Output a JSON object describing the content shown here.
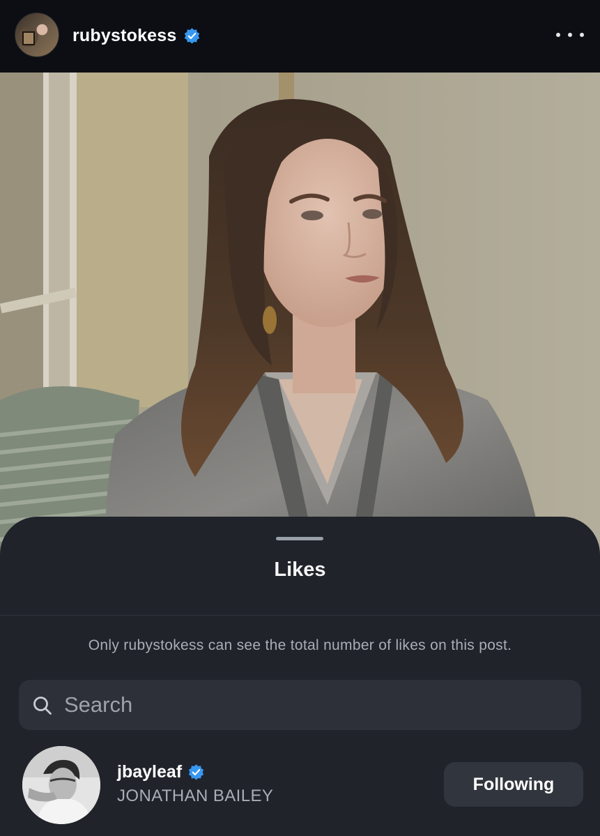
{
  "post": {
    "username": "rubystokess",
    "verified_icon": "verified-badge-icon",
    "more_icon": "more-horizontal-icon"
  },
  "likes_sheet": {
    "title": "Likes",
    "notice": "Only rubystokess can see the total number of likes on this post.",
    "search": {
      "placeholder": "Search",
      "value": "",
      "icon": "search-icon"
    },
    "users": [
      {
        "username": "jbayleaf",
        "full_name": "JONATHAN BAILEY",
        "verified": true,
        "button_label": "Following"
      }
    ]
  },
  "colors": {
    "header_bg": "#0c0e14",
    "sheet_bg": "#20232a",
    "search_bg": "#2d3038",
    "button_bg": "#31353d",
    "verified_blue": "#3897f0",
    "secondary_text": "#a9adb5"
  }
}
